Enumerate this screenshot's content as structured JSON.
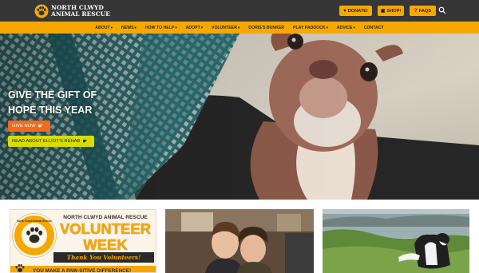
{
  "brand": {
    "line1": "NORTH CLWYD",
    "line2": "ANIMAL RESCUE",
    "accent": "#f7a800",
    "dark": "#363636"
  },
  "header_buttons": {
    "donate": "DONATE!",
    "shop": "SHOP!",
    "faqs": "FAQS"
  },
  "nav": [
    {
      "label": "ABOUT",
      "dropdown": true
    },
    {
      "label": "NEWS",
      "dropdown": true
    },
    {
      "label": "HOW TO HELP",
      "dropdown": true
    },
    {
      "label": "ADOPT",
      "dropdown": true
    },
    {
      "label": "VOLUNTEER",
      "dropdown": true
    },
    {
      "label": "DORIS'S BUNKER",
      "dropdown": false
    },
    {
      "label": "PLAY PADDOCK",
      "dropdown": true
    },
    {
      "label": "ADVICE",
      "dropdown": true
    },
    {
      "label": "CONTACT",
      "dropdown": false
    }
  ],
  "hero": {
    "title": "GIVE THE GIFT OF HOPE THIS YEAR",
    "give_button": "GIVE NOW",
    "read_button": "READ ABOUT ELLIOT'S REHAB",
    "give_color": "#f26b1d",
    "read_color": "#d8dd00"
  },
  "cards": {
    "volunteer": {
      "seal_text": "North Clwyd Animal Rescue",
      "heading": "NORTH CLWYD ANIMAL RESCUE",
      "title_line1": "VOLUNTEER",
      "title_line2": "WEEK",
      "banner": "Thank You Volunteers!",
      "footer": "YOU MAKE A PAW-SITIVE DIFFERENCE!"
    }
  }
}
